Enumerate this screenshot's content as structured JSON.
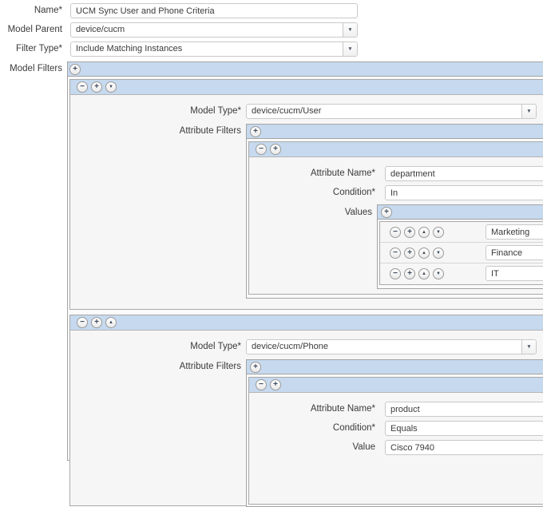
{
  "form": {
    "name": {
      "label": "Name*",
      "value": "UCM Sync User and Phone Criteria"
    },
    "model_parent": {
      "label": "Model Parent",
      "value": "device/cucm"
    },
    "filter_type": {
      "label": "Filter Type*",
      "value": "Include Matching Instances"
    },
    "model_filters": {
      "label": "Model Filters"
    }
  },
  "icons": {
    "plus": "+",
    "minus": "−",
    "up": "▲",
    "down": "▼",
    "dropdown": "▼"
  },
  "colors": {
    "bar_blue": "#c6d9ee",
    "border_gray": "#a4a4a4"
  },
  "panels": [
    {
      "model_type": {
        "label": "Model Type*",
        "value": "device/cucm/User"
      },
      "attribute_filters": {
        "label": "Attribute Filters"
      },
      "filter": {
        "attribute_name": {
          "label": "Attribute Name*",
          "value": "department"
        },
        "condition": {
          "label": "Condition*",
          "value": "In"
        },
        "values": {
          "label": "Values",
          "items": [
            "Marketing",
            "Finance",
            "IT"
          ]
        }
      }
    },
    {
      "model_type": {
        "label": "Model Type*",
        "value": "device/cucm/Phone"
      },
      "attribute_filters": {
        "label": "Attribute Filters"
      },
      "filter": {
        "attribute_name": {
          "label": "Attribute Name*",
          "value": "product"
        },
        "condition": {
          "label": "Condition*",
          "value": "Equals"
        },
        "value": {
          "label": "Value",
          "value": "Cisco 7940"
        }
      }
    }
  ]
}
